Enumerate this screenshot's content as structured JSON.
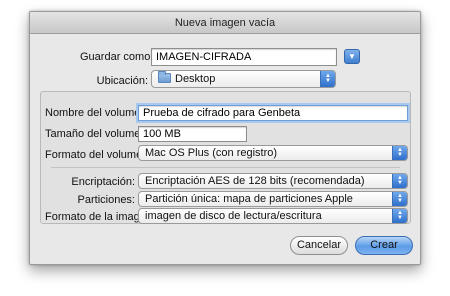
{
  "window": {
    "title": "Nueva imagen vacía"
  },
  "save_as": {
    "label": "Guardar como:",
    "value": "IMAGEN-CIFRADA",
    "disclosure_icon": "chevron-down-icon"
  },
  "location": {
    "label": "Ubicación:",
    "value": "Desktop",
    "icon": "folder-icon"
  },
  "volume": {
    "name_label": "Nombre del volumen:",
    "name_value": "Prueba de cifrado para Genbeta",
    "size_label": "Tamaño del volumen:",
    "size_value": "100 MB",
    "format_label": "Formato del volumen:",
    "format_value": "Mac OS Plus (con registro)"
  },
  "encryption": {
    "label": "Encriptación:",
    "value": "Encriptación AES de 128 bits (recomendada)"
  },
  "partitions": {
    "label": "Particiones:",
    "value": "Partición única: mapa de particiones Apple"
  },
  "image_format": {
    "label": "Formato de la imagen:",
    "value": "imagen de disco de lectura/escritura"
  },
  "buttons": {
    "cancel": "Cancelar",
    "create": "Crear"
  },
  "colors": {
    "accent": "#4a86d8",
    "window_bg": "#e8e8e8"
  }
}
